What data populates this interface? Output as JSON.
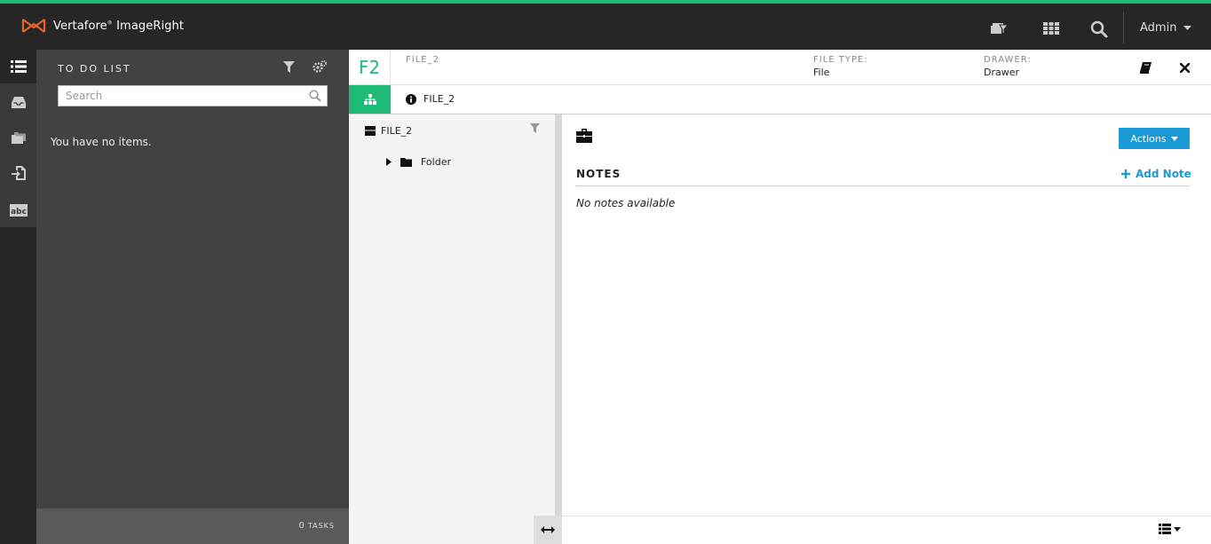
{
  "app": {
    "brand": "Vertafore",
    "product": "ImageRight",
    "accent_color": "#1dbb77",
    "user": "Admin"
  },
  "topbar": {
    "icons": [
      "bundle-filter-icon",
      "apps-grid-icon",
      "search-icon"
    ]
  },
  "rail": {
    "items": [
      "todo-list-icon",
      "inbox-icon",
      "folders-icon",
      "import-icon",
      "abc-icon"
    ]
  },
  "todo": {
    "title": "TO DO LIST",
    "search_placeholder": "Search",
    "empty_message": "You have no items.",
    "task_count": "0",
    "task_label": "tasks"
  },
  "file": {
    "badge": "F2",
    "name": "FILE_2",
    "file_type_label": "FILE TYPE:",
    "file_type_value": "File",
    "drawer_label": "DRAWER:",
    "drawer_value": "Drawer"
  },
  "tabs": {
    "info_label": "FILE_2"
  },
  "tree": {
    "root_label": "FILE_2",
    "children": [
      {
        "label": "Folder"
      }
    ]
  },
  "content": {
    "actions_label": "Actions",
    "notes_title": "NOTES",
    "add_note_label": "Add Note",
    "no_notes": "No notes available",
    "link_color": "#1a9ad6"
  }
}
